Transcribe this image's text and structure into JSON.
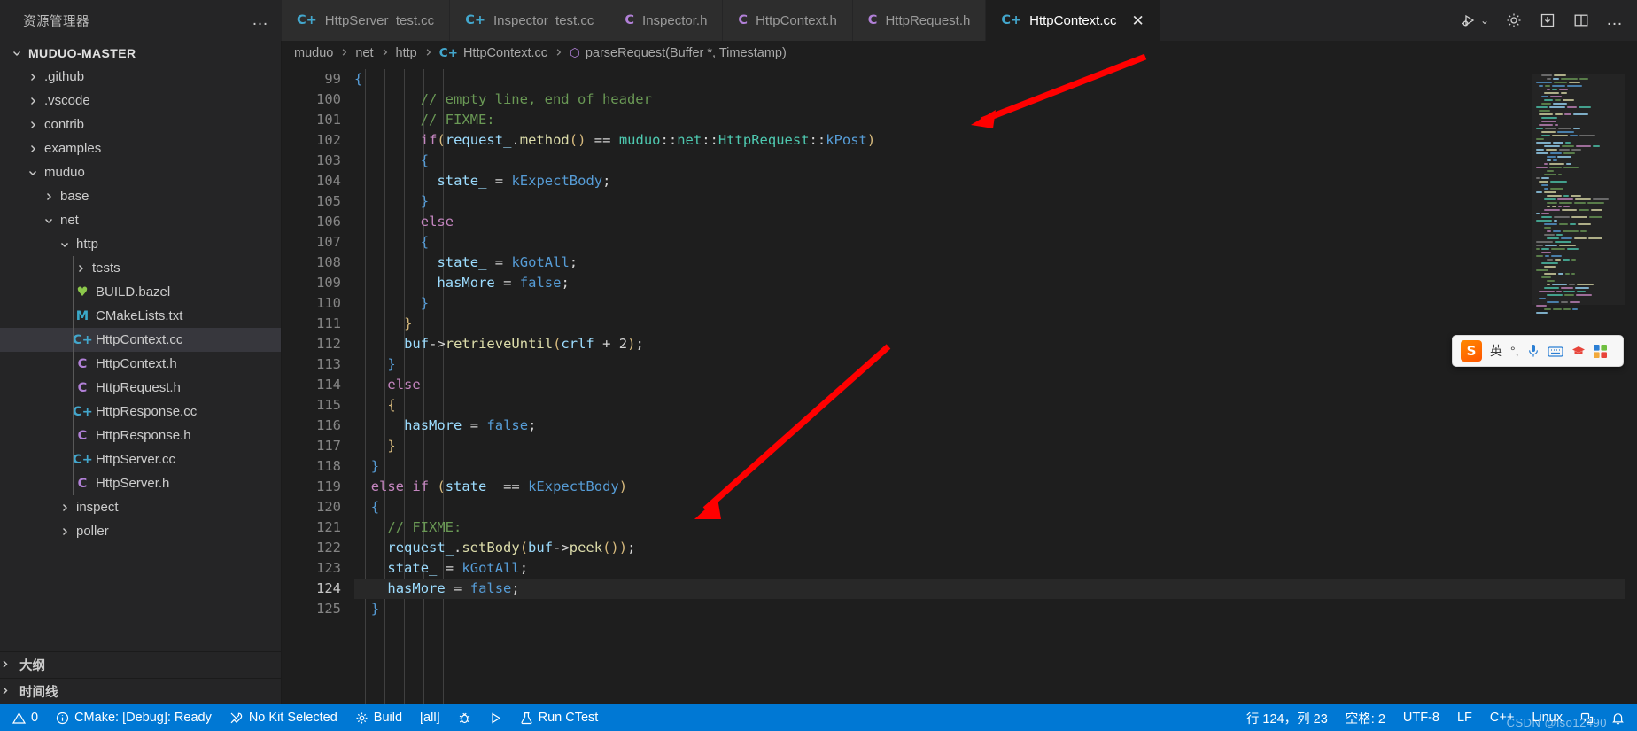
{
  "sidebar": {
    "title": "资源管理器",
    "more_actions": "…",
    "tree": [
      {
        "label": "MUDUO-MASTER",
        "depth": 0,
        "type": "root",
        "expanded": true
      },
      {
        "label": ".github",
        "depth": 1,
        "type": "folder",
        "expanded": false
      },
      {
        "label": ".vscode",
        "depth": 1,
        "type": "folder",
        "expanded": false
      },
      {
        "label": "contrib",
        "depth": 1,
        "type": "folder",
        "expanded": false
      },
      {
        "label": "examples",
        "depth": 1,
        "type": "folder",
        "expanded": false
      },
      {
        "label": "muduo",
        "depth": 1,
        "type": "folder",
        "expanded": true
      },
      {
        "label": "base",
        "depth": 2,
        "type": "folder",
        "expanded": false
      },
      {
        "label": "net",
        "depth": 2,
        "type": "folder",
        "expanded": true
      },
      {
        "label": "http",
        "depth": 3,
        "type": "folder",
        "expanded": true
      },
      {
        "label": "tests",
        "depth": 4,
        "type": "folder",
        "expanded": false
      },
      {
        "label": "BUILD.bazel",
        "depth": 4,
        "type": "file",
        "icon": "bazel-icon",
        "glyph": "♥"
      },
      {
        "label": "CMakeLists.txt",
        "depth": 4,
        "type": "file",
        "icon": "cmake-icon",
        "glyph": "M"
      },
      {
        "label": "HttpContext.cc",
        "depth": 4,
        "type": "file",
        "icon": "cpp-icon",
        "glyph": "C+",
        "selected": true
      },
      {
        "label": "HttpContext.h",
        "depth": 4,
        "type": "file",
        "icon": "header-icon",
        "glyph": "C"
      },
      {
        "label": "HttpRequest.h",
        "depth": 4,
        "type": "file",
        "icon": "header-icon",
        "glyph": "C"
      },
      {
        "label": "HttpResponse.cc",
        "depth": 4,
        "type": "file",
        "icon": "cpp-icon",
        "glyph": "C+"
      },
      {
        "label": "HttpResponse.h",
        "depth": 4,
        "type": "file",
        "icon": "header-icon",
        "glyph": "C"
      },
      {
        "label": "HttpServer.cc",
        "depth": 4,
        "type": "file",
        "icon": "cpp-icon",
        "glyph": "C+"
      },
      {
        "label": "HttpServer.h",
        "depth": 4,
        "type": "file",
        "icon": "header-icon",
        "glyph": "C"
      },
      {
        "label": "inspect",
        "depth": 3,
        "type": "folder",
        "expanded": false
      },
      {
        "label": "poller",
        "depth": 3,
        "type": "folder",
        "expanded": false
      }
    ],
    "sections": [
      {
        "label": "大纲",
        "expanded": false
      },
      {
        "label": "时间线",
        "expanded": false
      }
    ]
  },
  "tabs": [
    {
      "label": "HttpServer_test.cc",
      "icon": "cpp-icon",
      "glyph": "C+",
      "active": false
    },
    {
      "label": "Inspector_test.cc",
      "icon": "cpp-icon",
      "glyph": "C+",
      "active": false
    },
    {
      "label": "Inspector.h",
      "icon": "header-icon",
      "glyph": "C",
      "active": false
    },
    {
      "label": "HttpContext.h",
      "icon": "header-icon",
      "glyph": "C",
      "active": false
    },
    {
      "label": "HttpRequest.h",
      "icon": "header-icon",
      "glyph": "C",
      "active": false
    },
    {
      "label": "HttpContext.cc",
      "icon": "cpp-icon",
      "glyph": "C+",
      "active": true,
      "close": "✕"
    }
  ],
  "editor_actions": [
    {
      "name": "run-and-debug-icon",
      "label": ""
    },
    {
      "name": "chevron-down-icon",
      "label": "⌄"
    },
    {
      "name": "settings-gear-icon",
      "label": ""
    },
    {
      "name": "save-all-icon",
      "label": ""
    },
    {
      "name": "split-editor-icon",
      "label": ""
    },
    {
      "name": "more-actions-icon",
      "label": "…"
    }
  ],
  "breadcrumb": [
    {
      "label": "muduo"
    },
    {
      "label": "net"
    },
    {
      "label": "http"
    },
    {
      "label": "HttpContext.cc",
      "glyph": "C+",
      "icon": "cpp-icon"
    },
    {
      "label": "parseRequest(Buffer *, Timestamp)",
      "glyph": "⬡",
      "icon": "method-symbol-icon"
    }
  ],
  "code": {
    "first_line": 99,
    "current_line": 124,
    "lines": [
      {
        "n": 99,
        "text": "{",
        "partial": true
      },
      {
        "n": 100,
        "text": "        // empty line, end of header"
      },
      {
        "n": 101,
        "text": "        // FIXME:"
      },
      {
        "n": 102,
        "text": "        if(request_.method() == muduo::net::HttpRequest::kPost)"
      },
      {
        "n": 103,
        "text": "        {"
      },
      {
        "n": 104,
        "text": "          state_ = kExpectBody;"
      },
      {
        "n": 105,
        "text": "        }"
      },
      {
        "n": 106,
        "text": "        else"
      },
      {
        "n": 107,
        "text": "        {"
      },
      {
        "n": 108,
        "text": "          state_ = kGotAll;"
      },
      {
        "n": 109,
        "text": "          hasMore = false;"
      },
      {
        "n": 110,
        "text": "        }"
      },
      {
        "n": 111,
        "text": "      }"
      },
      {
        "n": 112,
        "text": "      buf->retrieveUntil(crlf + 2);"
      },
      {
        "n": 113,
        "text": "    }"
      },
      {
        "n": 114,
        "text": "    else"
      },
      {
        "n": 115,
        "text": "    {"
      },
      {
        "n": 116,
        "text": "      hasMore = false;"
      },
      {
        "n": 117,
        "text": "    }"
      },
      {
        "n": 118,
        "text": "  }"
      },
      {
        "n": 119,
        "text": "  else if (state_ == kExpectBody)"
      },
      {
        "n": 120,
        "text": "  {"
      },
      {
        "n": 121,
        "text": "    // FIXME:"
      },
      {
        "n": 122,
        "text": "    request_.setBody(buf->peek());"
      },
      {
        "n": 123,
        "text": "    state_ = kGotAll;"
      },
      {
        "n": 124,
        "text": "    hasMore = false;"
      },
      {
        "n": 125,
        "text": "  }",
        "partial": true
      }
    ]
  },
  "ime": {
    "logo": "S",
    "mode": "英",
    "punct": "°,",
    "items": [
      "microphone-icon",
      "keyboard-icon",
      "hat-icon",
      "toolbox-icon"
    ]
  },
  "status": {
    "left": [
      {
        "name": "problems-status",
        "icon": "warning-icon",
        "label": "0"
      },
      {
        "name": "cmake-status",
        "icon": "info-icon",
        "label": "CMake: [Debug]: Ready"
      },
      {
        "name": "kit-status",
        "icon": "tools-icon",
        "label": "No Kit Selected"
      },
      {
        "name": "build-status",
        "icon": "gear-icon",
        "label": "Build"
      },
      {
        "name": "target-status",
        "icon": "",
        "label": "[all]"
      },
      {
        "name": "debug-status",
        "icon": "bug-icon",
        "label": ""
      },
      {
        "name": "launch-status",
        "icon": "play-icon",
        "label": ""
      },
      {
        "name": "ctest-status",
        "icon": "beaker-icon",
        "label": "Run CTest"
      }
    ],
    "right": [
      {
        "name": "cursor-position-status",
        "label": "行 124，列 23"
      },
      {
        "name": "indentation-status",
        "label": "空格: 2"
      },
      {
        "name": "encoding-status",
        "label": "UTF-8"
      },
      {
        "name": "eol-status",
        "label": "LF"
      },
      {
        "name": "language-mode-status",
        "label": "C++"
      },
      {
        "name": "platform-status",
        "label": "Linux"
      },
      {
        "name": "remote-status",
        "label": ""
      },
      {
        "name": "notifications-status",
        "label": ""
      }
    ],
    "watermark": "CSDN @lso12490"
  },
  "colors": {
    "accent": "#0078d4",
    "editor_bg": "#1e1e1e",
    "sidebar_bg": "#252526",
    "tab_inactive": "#2d2d2d",
    "comment": "#6a9955",
    "keyword": "#c586c0",
    "variable": "#9cdcfe",
    "function": "#dcdcaa",
    "namespace": "#4ec9b0",
    "arrow": "#ff0000"
  }
}
